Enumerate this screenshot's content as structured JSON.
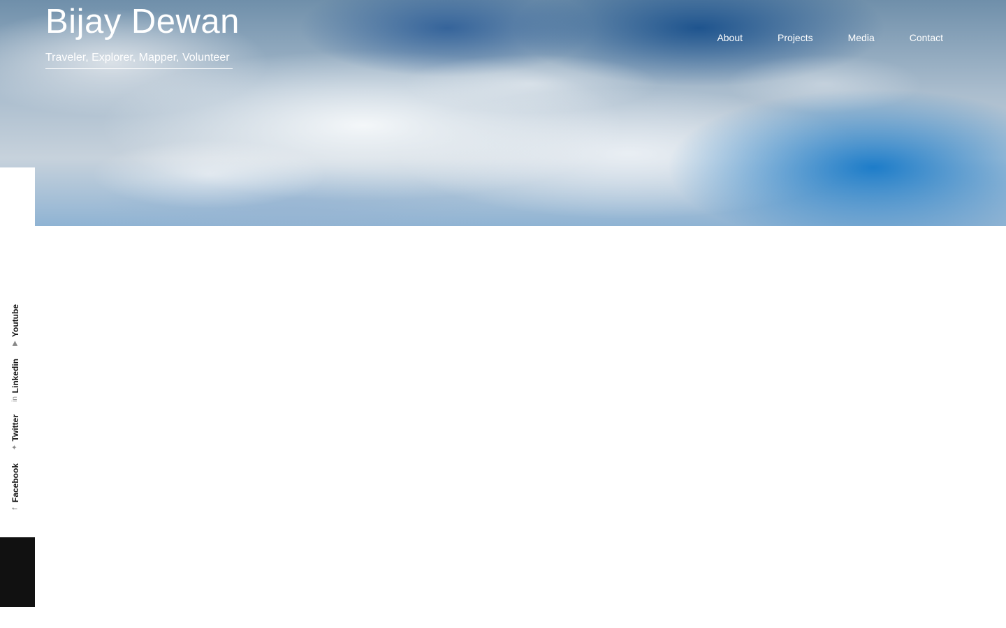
{
  "site": {
    "title": "Bijay Dewan",
    "tagline": "Traveler, Explorer, Mapper, Volunteer"
  },
  "nav": {
    "items": [
      {
        "label": "About"
      },
      {
        "label": "Projects"
      },
      {
        "label": "Media"
      },
      {
        "label": "Contact"
      }
    ]
  },
  "social": {
    "items": [
      {
        "label": "Youtube",
        "icon": "youtube-icon"
      },
      {
        "label": "Linkedin",
        "icon": "linkedin-icon"
      },
      {
        "label": "Twitter",
        "icon": "twitter-icon"
      },
      {
        "label": "Facebook",
        "icon": "facebook-icon"
      }
    ]
  },
  "colors": {
    "text_light": "#ffffff",
    "sidebar_block": "#111111",
    "social_text": "#111111"
  }
}
